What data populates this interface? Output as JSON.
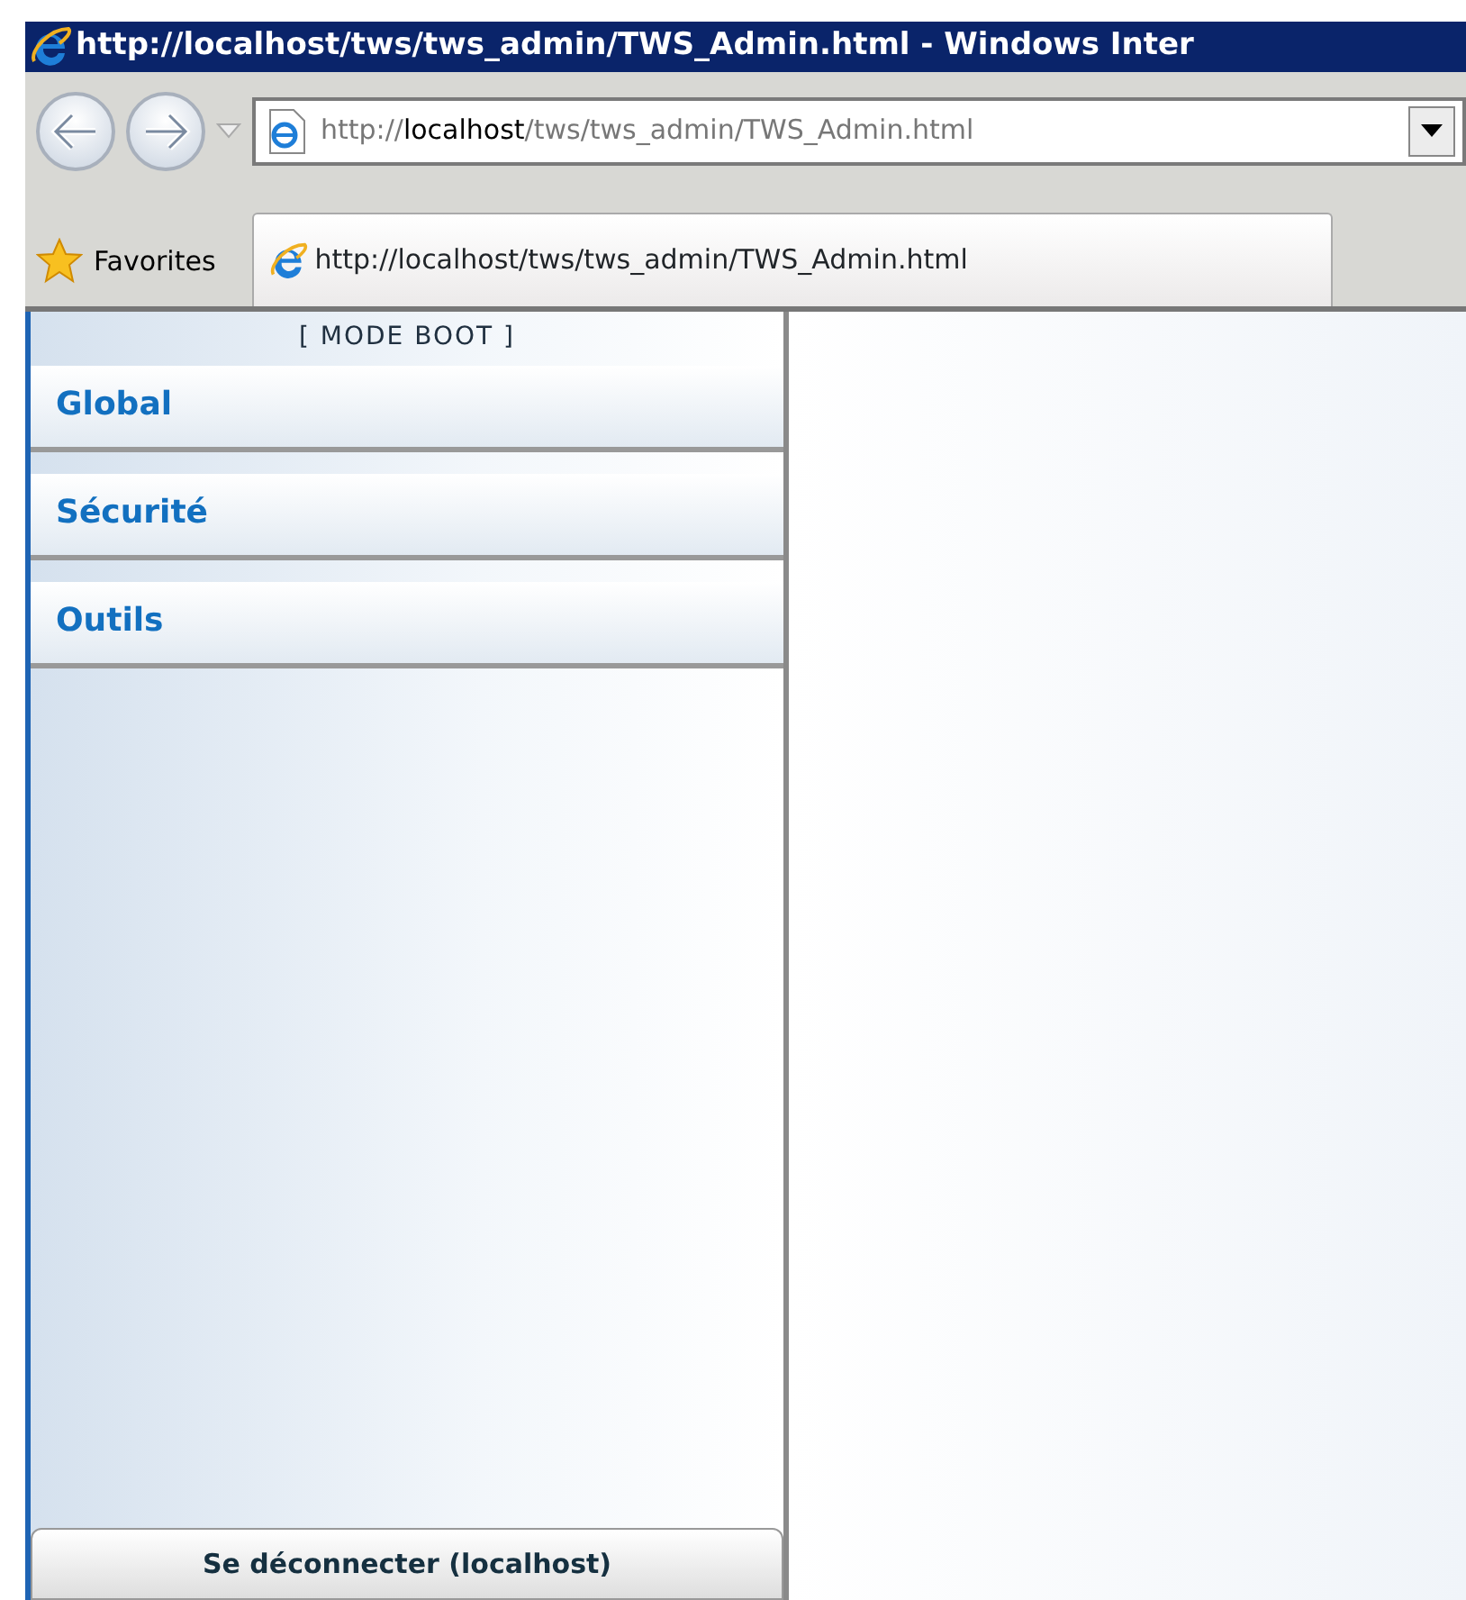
{
  "window": {
    "title": "http://localhost/tws/tws_admin/TWS_Admin.html - Windows Inter"
  },
  "address_bar": {
    "url": "http://**localhost**/tws/tws_admin/TWS_Admin.html"
  },
  "favorites": {
    "label": "Favorites"
  },
  "tab": {
    "title": "http://localhost/tws/tws_admin/TWS_Admin.html"
  },
  "sidebar": {
    "mode": "[ MODE BOOT ]",
    "items": [
      {
        "label": "Global"
      },
      {
        "label": "Sécurité"
      },
      {
        "label": "Outils"
      }
    ],
    "logout": "Se déconnecter (localhost)"
  }
}
